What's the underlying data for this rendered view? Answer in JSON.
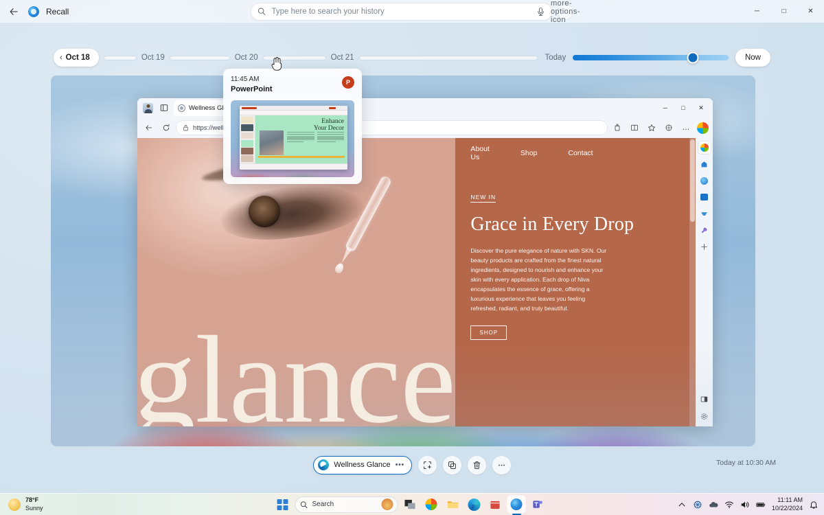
{
  "app": {
    "title": "Recall",
    "back_icon": "back-arrow-icon",
    "app_icon": "recall-icon"
  },
  "search": {
    "placeholder": "Type here to search your history",
    "value": "",
    "search_icon": "search-icon",
    "mic_icon": "microphone-icon",
    "more_icon": "more-options-icon"
  },
  "window_controls": {
    "minimize": "─",
    "maximize": "□",
    "close": "✕"
  },
  "timeline": {
    "selected_day": "Oct 18",
    "chevron": "‹",
    "days": [
      "Oct 19",
      "Oct 20",
      "Oct 21"
    ],
    "today_label": "Today",
    "now_label": "Now",
    "slider_position_pct": 77
  },
  "hover_card": {
    "time": "11:45 AM",
    "app": "PowerPoint",
    "badge_letter": "P",
    "thumbnail": {
      "slide_title_line1": "Enhance",
      "slide_title_line2": "Your Decor"
    }
  },
  "browser": {
    "tab": {
      "title": "Wellness Glance",
      "favicon": "globe-icon",
      "close_icon": "close-icon"
    },
    "profile_icon": "profile-avatar-icon",
    "tab_actions_icon": "tab-actions-icon",
    "nav": {
      "back_icon": "back-arrow-icon",
      "reload_icon": "reload-icon",
      "lock_icon": "lock-icon",
      "url": "https://wellnessglance.com"
    },
    "toolbar_icons": [
      "collections-icon",
      "split-screen-icon",
      "favorites-star-icon",
      "browser-essentials-icon",
      "settings-more-icon"
    ],
    "window_controls": {
      "minimize": "─",
      "maximize": "□",
      "close": "✕"
    },
    "sidebar_icons": [
      "copilot-icon",
      "edge-shopping-icon",
      "office-icon",
      "outlook-icon",
      "games-icon",
      "tools-icon",
      "add-sidebar-icon"
    ],
    "sidebar_bottom_icons": [
      "sidebar-toggle-icon",
      "sidebar-settings-icon"
    ]
  },
  "website": {
    "nav_links": [
      "About Us",
      "Shop",
      "Contact"
    ],
    "cart_icon": "shopping-cart-icon",
    "account_icon": "user-account-icon",
    "eyebrow": "NEW IN",
    "headline": "Grace in Every Drop",
    "paragraph": "Discover the pure elegance of nature with SKN. Our beauty products are crafted from the finest natural ingredients, designed to nourish and enhance your skin with every application. Each drop of Niva encapsulates the essence of grace, offering a luxurious experience that leaves you feeling refreshed, radiant, and truly beautiful.",
    "cta_label": "SHOP",
    "big_word": "glance"
  },
  "bottom_bar": {
    "app_name": "Wellness Glance",
    "app_icon": "edge-icon",
    "app_dots": "•••",
    "actions": [
      {
        "name": "snip-icon",
        "label": "Snip"
      },
      {
        "name": "copy-icon",
        "label": "Copy"
      },
      {
        "name": "delete-icon",
        "label": "Delete"
      },
      {
        "name": "more-icon",
        "label": "More"
      }
    ],
    "timestamp": "Today at 10:30 AM"
  },
  "taskbar": {
    "weather": {
      "temperature": "78°F",
      "condition": "Sunny",
      "icon": "sun-icon"
    },
    "start_icon": "start-button-icon",
    "search": {
      "label": "Search",
      "icon": "search-icon"
    },
    "apps": [
      {
        "name": "task-view-icon"
      },
      {
        "name": "copilot-icon"
      },
      {
        "name": "file-explorer-icon"
      },
      {
        "name": "edge-icon"
      },
      {
        "name": "microsoft-store-icon"
      },
      {
        "name": "recall-icon",
        "active": true
      },
      {
        "name": "teams-icon"
      }
    ],
    "tray": {
      "overflow_icon": "chevron-up-icon",
      "onedrive_sync_icon": "sync-icon",
      "cloud_icon": "onedrive-icon",
      "wifi_icon": "wifi-icon",
      "volume_icon": "volume-icon",
      "battery_icon": "battery-icon",
      "time": "11:11 AM",
      "date": "10/22/2024",
      "notification_icon": "notification-bell-icon"
    }
  },
  "colors": {
    "accent": "#0f6cbd",
    "brand_terracotta": "#b5674a",
    "cream": "#f5ece2",
    "powerpoint_red": "#c43e1c"
  }
}
